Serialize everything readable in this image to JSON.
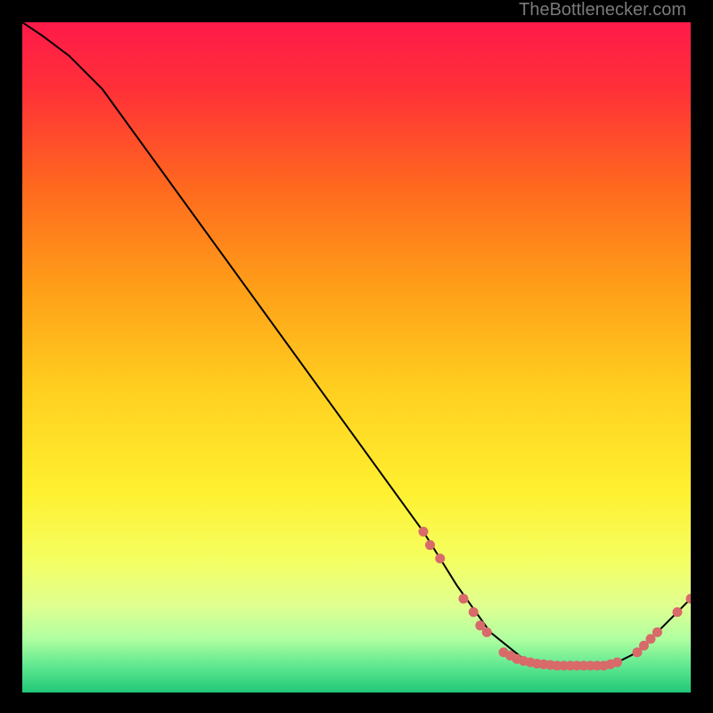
{
  "watermark": "TheBottleneсker.com",
  "chart_data": {
    "type": "line",
    "title": "",
    "xlabel": "",
    "ylabel": "",
    "xlim": [
      0,
      100
    ],
    "ylim": [
      0,
      100
    ],
    "background_gradient": {
      "stops": [
        {
          "offset": 0,
          "color": "#ff1a4a"
        },
        {
          "offset": 10,
          "color": "#ff3038"
        },
        {
          "offset": 25,
          "color": "#ff6a1e"
        },
        {
          "offset": 40,
          "color": "#ffa018"
        },
        {
          "offset": 55,
          "color": "#ffd020"
        },
        {
          "offset": 70,
          "color": "#fff030"
        },
        {
          "offset": 80,
          "color": "#f5ff60"
        },
        {
          "offset": 87,
          "color": "#e0ff90"
        },
        {
          "offset": 92,
          "color": "#b0ffa0"
        },
        {
          "offset": 96,
          "color": "#60e890"
        },
        {
          "offset": 100,
          "color": "#20c878"
        }
      ]
    },
    "curve": [
      {
        "x": 0,
        "y": 100
      },
      {
        "x": 3,
        "y": 98
      },
      {
        "x": 7,
        "y": 95
      },
      {
        "x": 12,
        "y": 90
      },
      {
        "x": 60,
        "y": 24
      },
      {
        "x": 65,
        "y": 16
      },
      {
        "x": 70,
        "y": 9
      },
      {
        "x": 75,
        "y": 5
      },
      {
        "x": 80,
        "y": 4
      },
      {
        "x": 85,
        "y": 4
      },
      {
        "x": 88,
        "y": 4
      },
      {
        "x": 92,
        "y": 6
      },
      {
        "x": 96,
        "y": 10
      },
      {
        "x": 100,
        "y": 14
      }
    ],
    "dots": [
      {
        "x": 60,
        "y": 24
      },
      {
        "x": 61,
        "y": 22
      },
      {
        "x": 62.5,
        "y": 20
      },
      {
        "x": 66,
        "y": 14
      },
      {
        "x": 67.5,
        "y": 12
      },
      {
        "x": 68.5,
        "y": 10
      },
      {
        "x": 69.5,
        "y": 9
      },
      {
        "x": 72,
        "y": 6
      },
      {
        "x": 73,
        "y": 5.5
      },
      {
        "x": 74,
        "y": 5
      },
      {
        "x": 75,
        "y": 4.7
      },
      {
        "x": 76,
        "y": 4.5
      },
      {
        "x": 77,
        "y": 4.3
      },
      {
        "x": 78,
        "y": 4.2
      },
      {
        "x": 79,
        "y": 4.1
      },
      {
        "x": 80,
        "y": 4
      },
      {
        "x": 81,
        "y": 4
      },
      {
        "x": 82,
        "y": 4
      },
      {
        "x": 83,
        "y": 4
      },
      {
        "x": 84,
        "y": 4
      },
      {
        "x": 85,
        "y": 4
      },
      {
        "x": 86,
        "y": 4
      },
      {
        "x": 87,
        "y": 4
      },
      {
        "x": 88,
        "y": 4.2
      },
      {
        "x": 89,
        "y": 4.5
      },
      {
        "x": 92,
        "y": 6
      },
      {
        "x": 93,
        "y": 7
      },
      {
        "x": 94,
        "y": 8
      },
      {
        "x": 95,
        "y": 9
      },
      {
        "x": 98,
        "y": 12
      },
      {
        "x": 100,
        "y": 14
      }
    ]
  }
}
